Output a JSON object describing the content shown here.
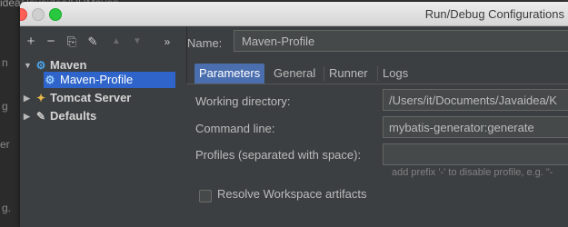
{
  "background": {
    "breadcrumb": "idea/Javaidea/HRMaven",
    "side_fragments": [
      "n",
      "g",
      "er",
      "g."
    ]
  },
  "window": {
    "title": "Run/Debug Configurations"
  },
  "toolbar": {
    "add": "+",
    "remove": "−",
    "copy": "⎘",
    "edit": "✎",
    "move_up": "▲",
    "move_down": "▼",
    "more": "»"
  },
  "tree": {
    "maven": "Maven",
    "maven_profile": "Maven-Profile",
    "tomcat": "Tomcat Server",
    "defaults": "Defaults"
  },
  "form": {
    "name_label": "Name:",
    "name_value": "Maven-Profile",
    "tabs": [
      "Parameters",
      "General",
      "Runner",
      "Logs"
    ],
    "active_tab": "Parameters",
    "working_dir_label": "Working directory:",
    "working_dir_value": "/Users/it/Documents/Javaidea/K",
    "command_line_label": "Command line:",
    "command_line_value": "mybatis-generator:generate",
    "profiles_label": "Profiles (separated with space):",
    "profiles_value": "",
    "profiles_hint": "add prefix '-' to disable profile, e.g. \"-",
    "resolve_label": "Resolve Workspace artifacts",
    "resolve_checked": false
  },
  "colors": {
    "selection": "#2f65ca",
    "active_tab": "#4b6eaf",
    "panel": "#3c3f41"
  }
}
